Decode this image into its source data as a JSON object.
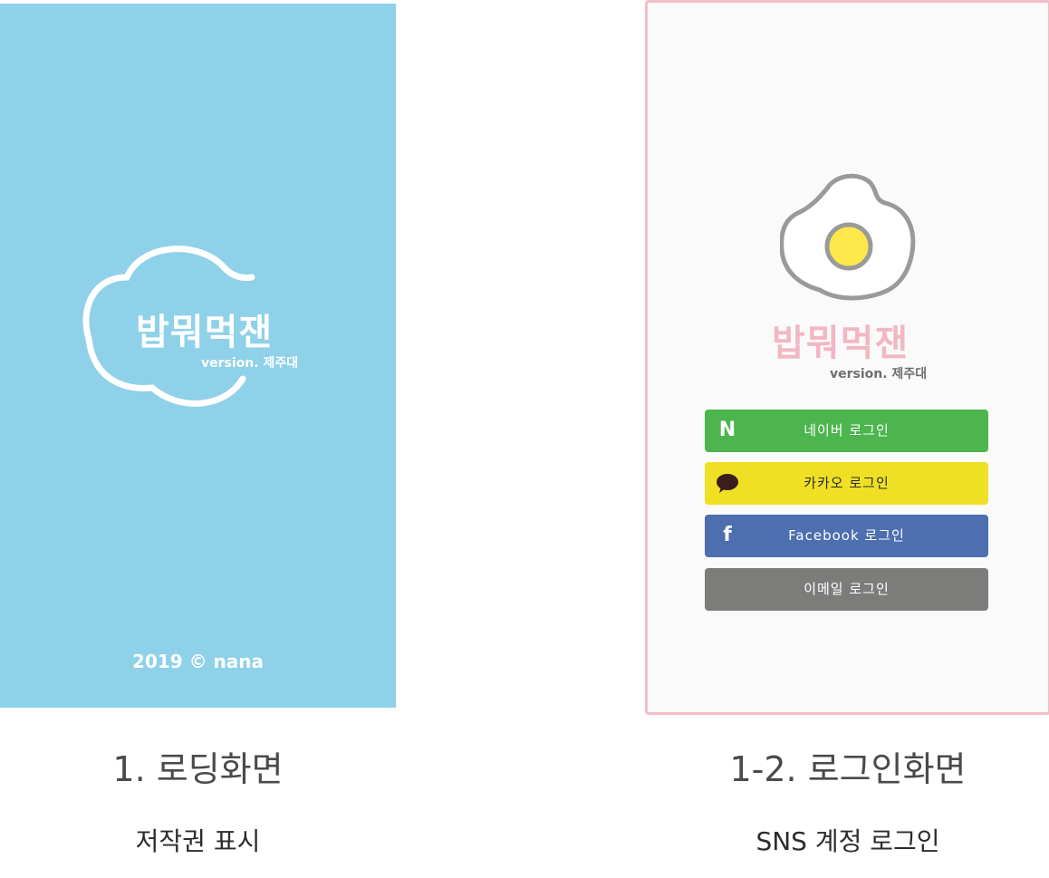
{
  "loading_screen": {
    "app_title": "밥뭐먹잰",
    "version": "version. 제주대",
    "copyright": "2019 © nana"
  },
  "login_screen": {
    "app_title": "밥뭐먹잰",
    "version": "version. 제주대",
    "buttons": {
      "naver": "네이버 로그인",
      "kakao": "카카오 로그인",
      "facebook": "Facebook 로그인",
      "email": "이메일 로그인"
    },
    "icons": {
      "naver": "N",
      "facebook": "f"
    }
  },
  "captions": {
    "screen1_title": "1. 로딩화면",
    "screen1_desc": "저작권 표시",
    "screen2_title": "1-2. 로그인화면",
    "screen2_desc": "SNS 계정 로그인"
  },
  "colors": {
    "loading_bg": "#8ed1e8",
    "login_border": "#f2bec9",
    "login_bg": "#fafafa",
    "naver": "#4cb54e",
    "kakao": "#f0e024",
    "facebook": "#4d6fb0",
    "email": "#7c7d7b",
    "title_pink": "#f2b7c3",
    "egg_yolk": "#fde84a"
  }
}
